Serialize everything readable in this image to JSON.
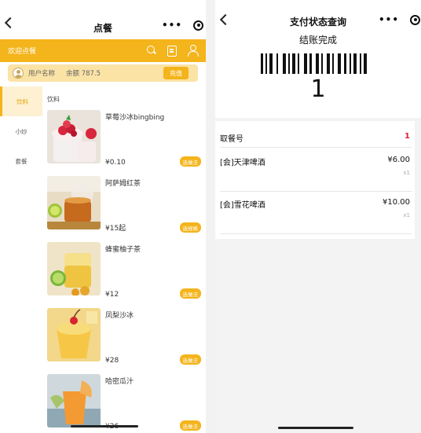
{
  "left": {
    "nav_title": "点餐",
    "more_dots": "•••",
    "welcome": "欢迎点餐",
    "user_name": "用户名称",
    "balance": "余额 787.5",
    "recharge": "充值",
    "categories": [
      "饮料",
      "小炒",
      "套餐"
    ],
    "section_title": "饮料",
    "products": [
      {
        "name": "草莓沙冰bingbing",
        "price": "¥0.10",
        "button": "选做法"
      },
      {
        "name": "阿萨姆红茶",
        "price": "¥15起",
        "button": "选规格"
      },
      {
        "name": "蜂蜜柚子茶",
        "price": "¥12",
        "button": "选做法"
      },
      {
        "name": "凤梨沙冰",
        "price": "¥28",
        "button": "选做法"
      },
      {
        "name": "哈密瓜汁",
        "price": "¥26",
        "button": "选做法"
      }
    ]
  },
  "right": {
    "nav_title": "支付状态查询",
    "more_dots": "•••",
    "status": "结账完成",
    "pickup_number": "1",
    "pickup_label": "取餐号",
    "pickup_value": "1",
    "items": [
      {
        "name": "[会]天津啤酒",
        "price": "¥6.00",
        "qty": "x1"
      },
      {
        "name": "[会]雪花啤酒",
        "price": "¥10.00",
        "qty": "x1"
      }
    ]
  },
  "colors": {
    "accent": "#f4b41c",
    "accent_light": "#fbe3a6",
    "red": "#e0202b"
  }
}
